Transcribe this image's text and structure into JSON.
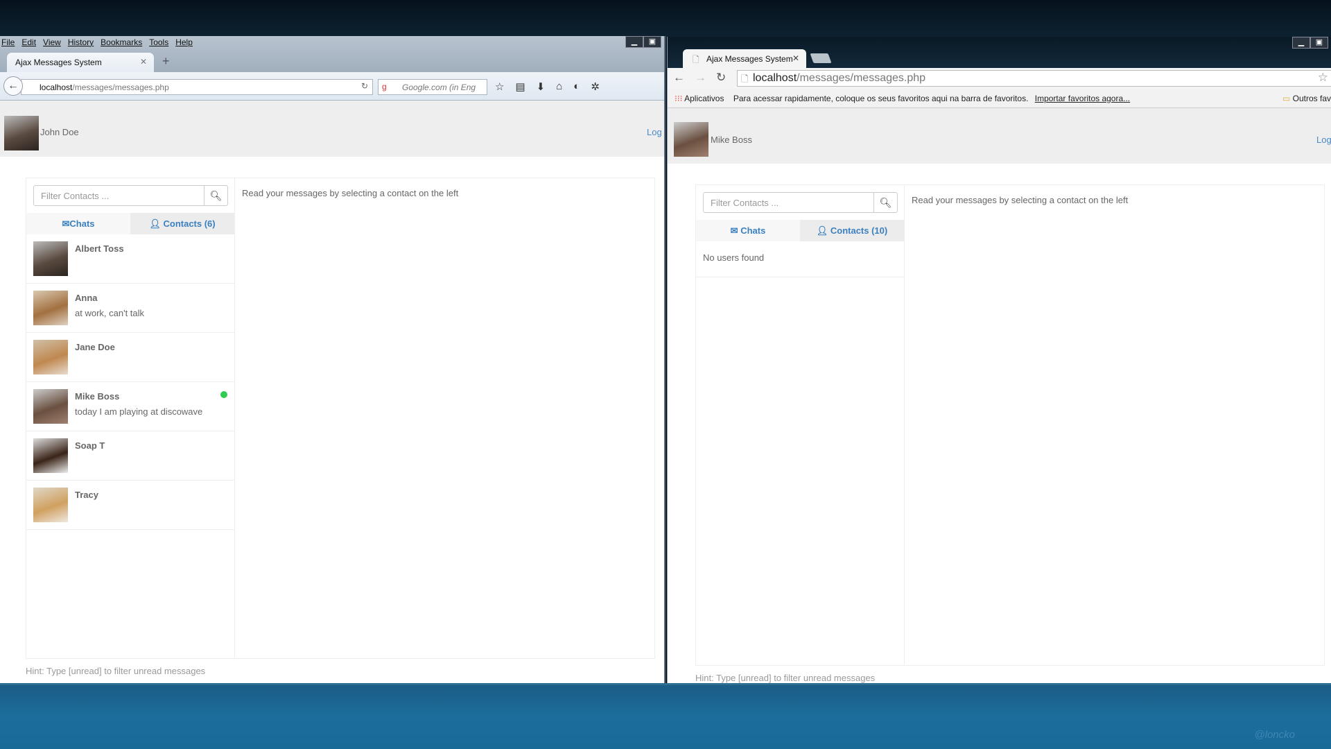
{
  "firefox": {
    "menu": [
      "File",
      "Edit",
      "View",
      "History",
      "Bookmarks",
      "Tools",
      "Help"
    ],
    "tab_title": "Ajax Messages System",
    "url_host": "localhost",
    "url_path": "/messages/messages.php",
    "search_placeholder": "Google.com (in Eng",
    "user": "John Doe",
    "logout": "Log",
    "search_placeholder_contacts": "Filter Contacts ...",
    "tab_chats": "Chats",
    "tab_contacts": "Contacts (6)",
    "contacts": [
      {
        "name": "Albert Toss",
        "status": "",
        "online": false
      },
      {
        "name": "Anna",
        "status": "at work, can't talk",
        "online": false
      },
      {
        "name": "Jane Doe",
        "status": "",
        "online": false
      },
      {
        "name": "Mike Boss",
        "status": "today I am playing at discowave",
        "online": true
      },
      {
        "name": "Soap T",
        "status": "",
        "online": false
      },
      {
        "name": "Tracy",
        "status": "",
        "online": false
      }
    ],
    "read_msg": "Read your messages by selecting a contact on the left",
    "hint": "Hint: Type [unread] to filter unread messages"
  },
  "chrome": {
    "tab_title": "Ajax Messages System",
    "url_host": "localhost",
    "url_path": "/messages/messages.php",
    "apps": "Aplicativos",
    "bookmarks_msg": "Para acessar rapidamente, coloque os seus favoritos aqui na barra de favoritos.",
    "import_link": "Importar favoritos agora...",
    "other_bookmarks": "Outros fav",
    "user": "Mike Boss",
    "logout": "Log",
    "search_placeholder_contacts": "Filter Contacts ...",
    "tab_chats": "Chats",
    "tab_contacts": "Contacts (10)",
    "no_users": "No users found",
    "read_msg": "Read your messages by selecting a contact on the left",
    "hint": "Hint: Type [unread] to filter unread messages"
  },
  "watermark": "@loncko",
  "colors": {
    "accent": "#4a89c5",
    "online": "#2ecc51"
  }
}
